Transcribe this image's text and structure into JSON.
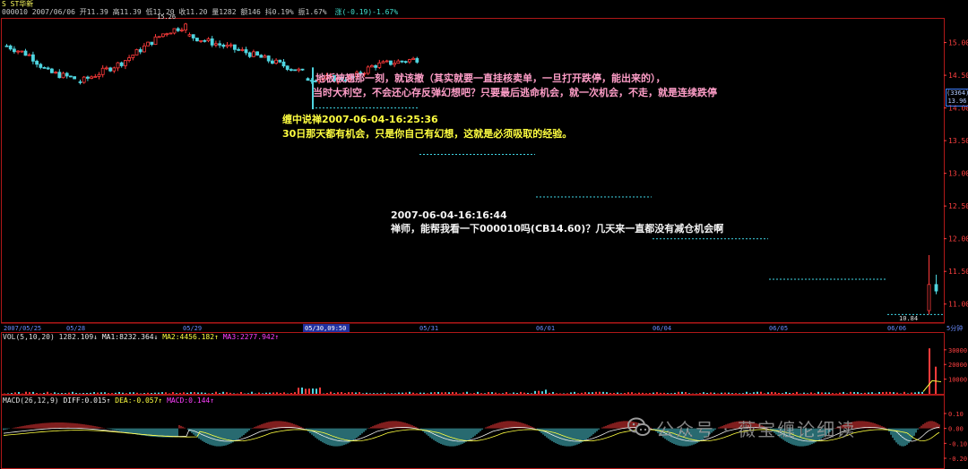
{
  "header": {
    "name": "S ST华新",
    "quote": "000010 2007/06/06 开11.39 高11.39 低11.20 收11.20 量1282 额146 抖0.19% 振1.67%",
    "change": "涨(-0.19)-1.67%"
  },
  "indicators": {
    "vol": {
      "label": "VOL(5,10,20)",
      "value": "1282.109↓",
      "ma1": "MA1:8232.364↓",
      "ma2": "MA2:4456.182↑",
      "ma3": "MA3:2277.942↑"
    },
    "macd": {
      "label": "MACD(26,12,9)",
      "diff": "DIFF:0.015↑",
      "dea": "DEA:-0.057↑",
      "macd": "MACD:0.144↑"
    }
  },
  "annotations": {
    "pink_line1": "地板被翘那一刻，就该撤（其实就要一直挂核卖单，一旦打开跌停，能出来的），",
    "pink_line2": "当时大利空，不会还心存反弹幻想吧？只要最后逃命机会，就一次机会，不走，就是连续跌停",
    "yellow_line1": "缠中说禅2007-06-04-16:25:36",
    "yellow_line2": "30日那天都有机会，只是你自己有幻想，这就是必须吸取的经验。",
    "white_line1": "2007-06-04-16:16:44",
    "white_line2": "禅师，能帮我看一下000010吗(CB14.60)？几天来一直都没有减仓机会啊"
  },
  "watermark": "公众号 · 薇宝缠论细读",
  "price_tag_top": "(3364)",
  "price_tag_bottom": "13.96",
  "colors": {
    "up": "#ff3b3b",
    "down": "#4fd5e0",
    "frame": "#b01818",
    "axis": "#ff4040",
    "ma1": "#f0f0f0",
    "ma2": "#ffff40",
    "ma3": "#ff40ff"
  },
  "chart_data": [
    {
      "type": "candlestick",
      "title": "S ST华新",
      "y_ticks": [
        "15.00",
        "14.50",
        "14.00",
        "13.50",
        "13.00",
        "12.50",
        "12.00",
        "11.50",
        "11.00"
      ],
      "ylim": [
        10.75,
        15.35
      ],
      "x_ticks": [
        "2007/05/25",
        "05/28",
        "05/29",
        "05/30,09:50",
        "05/31",
        "06/01",
        "06/04",
        "06/05",
        "06/06",
        "5分钟"
      ],
      "high_label": "15.26",
      "low_label": "10.84",
      "series": [
        {
          "name": "session_05_25",
          "trend": [
            [
              0,
              14.95
            ],
            [
              0.35,
              14.8
            ],
            [
              0.6,
              14.55
            ],
            [
              1,
              14.45
            ]
          ]
        },
        {
          "name": "session_05_28",
          "trend": [
            [
              0,
              14.4
            ],
            [
              0.4,
              14.7
            ],
            [
              0.8,
              15.15
            ],
            [
              1,
              15.26
            ]
          ]
        },
        {
          "name": "session_05_29",
          "trend": [
            [
              0,
              15.1
            ],
            [
              0.5,
              14.85
            ],
            [
              1,
              14.55
            ]
          ]
        },
        {
          "name": "session_05_30",
          "trend": [
            [
              0,
              14.45
            ],
            [
              0.4,
              14.45
            ],
            [
              0.6,
              14.65
            ],
            [
              1,
              14.75
            ]
          ]
        }
      ],
      "limit_down_levels": [
        {
          "session": "05/30",
          "price": 14.0
        },
        {
          "session": "05/31",
          "price": 13.29
        },
        {
          "session": "06/01",
          "price": 12.64
        },
        {
          "session": "06/04",
          "price": 12.0
        },
        {
          "session": "06/05",
          "price": 11.38
        },
        {
          "session": "06/06",
          "price": 10.84
        }
      ],
      "last_bars": [
        {
          "open": 10.9,
          "high": 11.75,
          "low": 10.84,
          "close": 11.3
        },
        {
          "open": 11.3,
          "high": 11.45,
          "low": 11.15,
          "close": 11.2
        }
      ]
    },
    {
      "type": "bar",
      "name": "VOL",
      "y_ticks": [
        "30000",
        "20000",
        "10000"
      ],
      "ylim": [
        0,
        36000
      ],
      "spike_values": [
        31000,
        18500
      ]
    },
    {
      "type": "bar",
      "name": "MACD",
      "y_ticks": [
        "0.10",
        "0.00",
        "-0.10",
        "-0.20"
      ],
      "ylim": [
        -0.26,
        0.16
      ]
    }
  ]
}
